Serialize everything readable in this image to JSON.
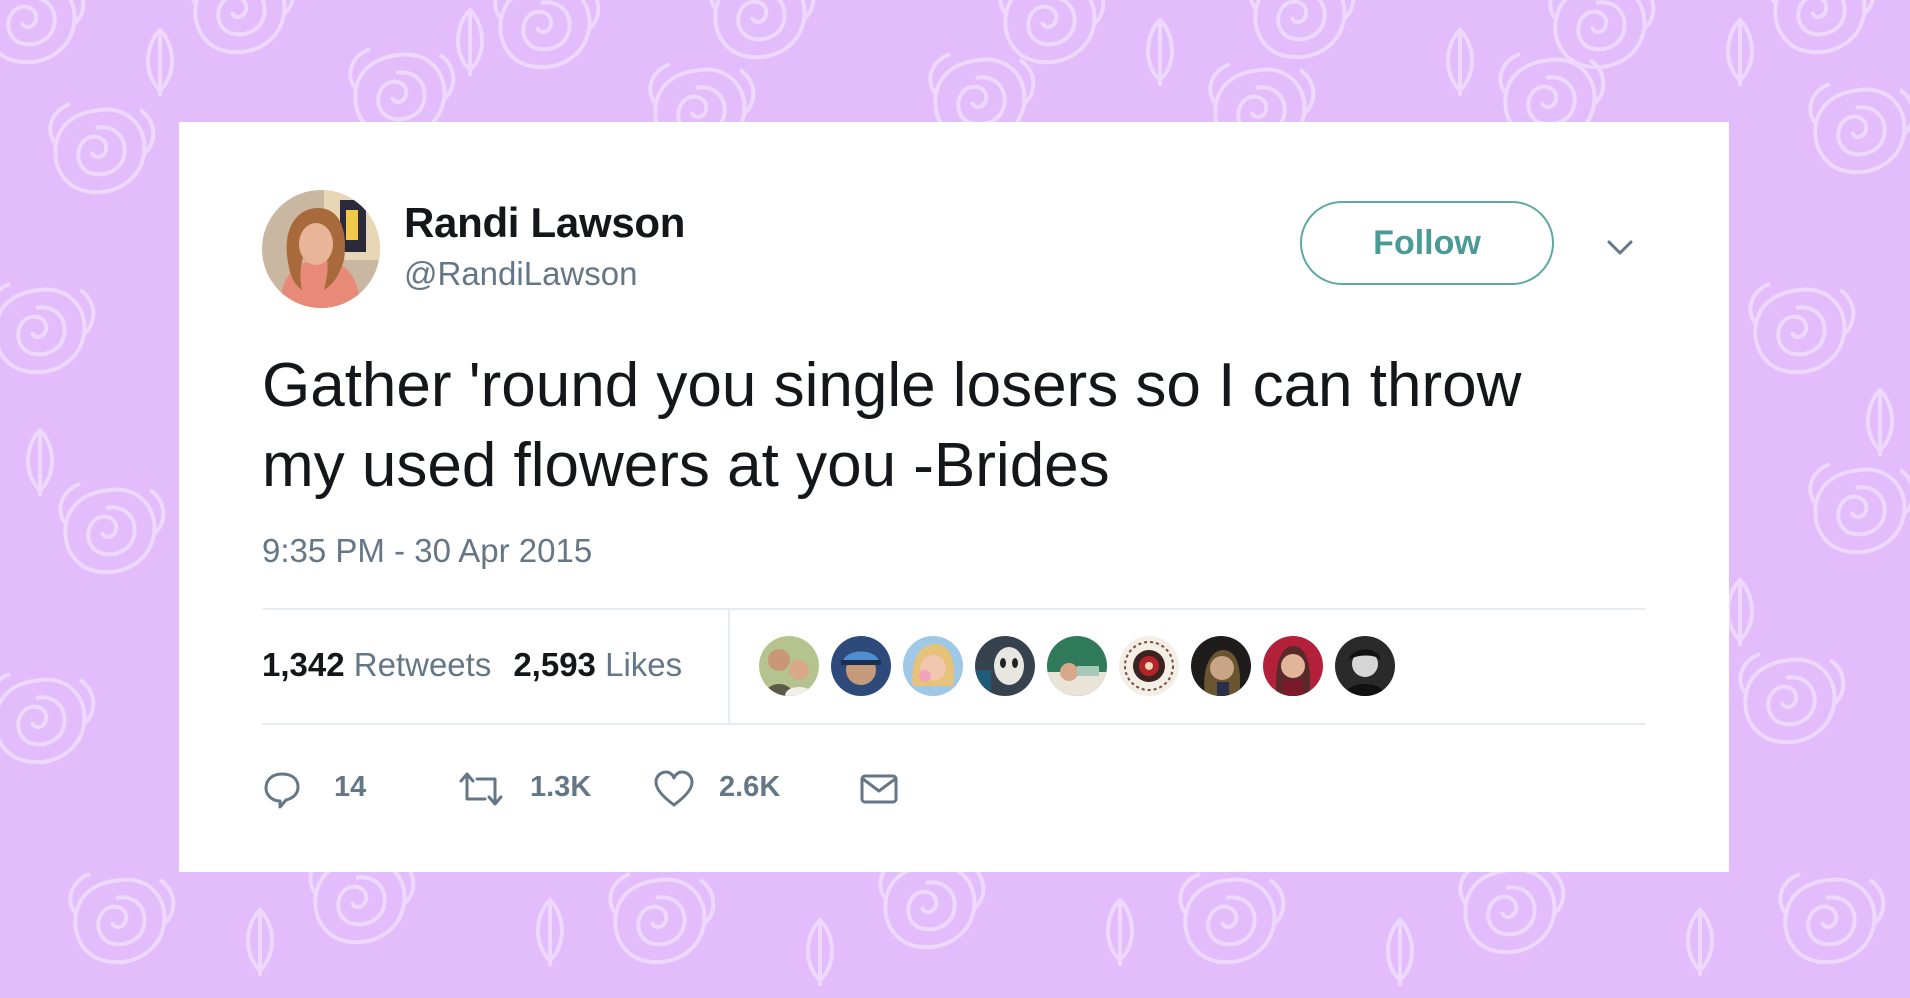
{
  "theme": {
    "background": "#e2bcfb",
    "pattern_stroke": "#f0dcfd",
    "card": "#ffffff",
    "accent": "#4a9a95",
    "text": "#14171a",
    "muted": "#657786"
  },
  "tweet": {
    "author": {
      "name": "Randi Lawson",
      "handle": "@RandiLawson"
    },
    "follow_label": "Follow",
    "text": "Gather 'round you single losers so I can throw my used flowers at you  -Brides",
    "timestamp": "9:35 PM - 30 Apr 2015",
    "stats": {
      "retweets_count": "1,342",
      "retweets_label": "Retweets",
      "likes_count": "2,593",
      "likes_label": "Likes"
    },
    "liker_avatars": [
      {
        "icon": "avatar-two-boys"
      },
      {
        "icon": "avatar-cap"
      },
      {
        "icon": "avatar-blonde"
      },
      {
        "icon": "avatar-mask"
      },
      {
        "icon": "avatar-green"
      },
      {
        "icon": "avatar-badge"
      },
      {
        "icon": "avatar-dark"
      },
      {
        "icon": "avatar-red"
      },
      {
        "icon": "avatar-bw"
      }
    ],
    "actions": {
      "reply_count": "14",
      "retweet_count": "1.3K",
      "like_count": "2.6K"
    }
  }
}
